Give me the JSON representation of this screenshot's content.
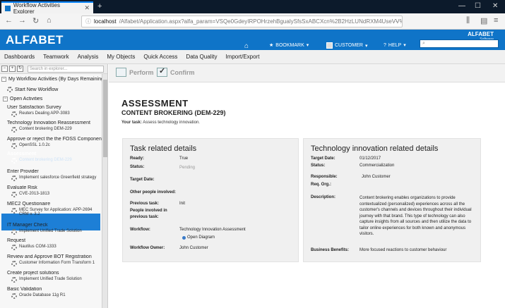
{
  "browser": {
    "tab_title": "Workflow Activities Explorer",
    "url_host": "localhost",
    "url_rest": "/Alfabet/Application.aspx?alfa_param=VSQe0GdeyIRPOHrzehBgualySfsSxABCXcn%2B2HzLUNdRXM4UseVV%2FbVP1S1B"
  },
  "app": {
    "logo": "ALFABET",
    "brand_right": "ALFABET",
    "brand_sub": "Software",
    "nav_bookmark": "BOOKMARK",
    "nav_customer": "CUSTOMER",
    "nav_help": "HELP"
  },
  "menu": [
    "Dashboards",
    "Teamwork",
    "Analysis",
    "My Objects",
    "Quick Access",
    "Data Quality",
    "Import/Export"
  ],
  "sidebar": {
    "search_placeholder": "Search in explorer...",
    "root": "My Workflow Activities (By Days Remaining",
    "start_new": "Start New Workflow",
    "open_activities": "Open Activities",
    "items": [
      {
        "title": "User Satisfaction Survey",
        "sub": "Reuters Dealing APP-3083"
      },
      {
        "title": "Technology Innovation Reassessment",
        "sub": "Content brokering DEM-229"
      },
      {
        "title": "Approve or reject the the FOSS Component",
        "sub": "OpenSSL 1.0.2c"
      },
      {
        "title": "Assessment",
        "sub": "Content brokering DEM-229"
      },
      {
        "title": "Enter Provider",
        "sub": "Implement salesforce Greenfield strategy"
      },
      {
        "title": "Evaluate Risk",
        "sub": "CVE-2013-1813"
      },
      {
        "title": "MEC2 Questionaire",
        "sub": "MEC Survey for Application: APP-2694 CRM v. 3.2"
      },
      {
        "title": "IT Manager Check",
        "sub": "Implement Unified Trade Solution"
      },
      {
        "title": "Request",
        "sub": "Nautilus COM-1333"
      },
      {
        "title": "Review and Approve BOT Registration",
        "sub": "Customer Information Form Transform 1"
      },
      {
        "title": "Create project solutions",
        "sub": "Implement Unified Trade Solution"
      },
      {
        "title": "Basic Validation",
        "sub": "Oracle Database 11g R1"
      }
    ]
  },
  "actions": {
    "perform": "Perform",
    "confirm": "Confirm"
  },
  "assessment": {
    "title": "ASSESSMENT",
    "subtitle": "CONTENT BROKERING (DEM-229)",
    "task_label": "Your task:",
    "task_text": "Assess technology innovation."
  },
  "task_panel": {
    "heading": "Task related details",
    "ready_label": "Ready:",
    "ready_value": "True",
    "status_label": "Status:",
    "status_value": "Pending",
    "target_label": "Target Date:",
    "others_label": "Other people involved:",
    "prev_task_label": "Previous task:",
    "prev_task_value": "Init",
    "people_prev_label_1": "People involved in",
    "people_prev_label_2": "previous task:",
    "workflow_label": "Workflow:",
    "workflow_value": "Technology Innovation Assessment",
    "open_diagram": "Open Diagram",
    "owner_label": "Workflow Owner:",
    "owner_value": "John Customer"
  },
  "tech_panel": {
    "heading": "Technology innovation related details",
    "target_label": "Target Date:",
    "target_value": "01/12/2017",
    "status_label": "Status:",
    "status_value": "Commercialization",
    "responsible_label": "Responsible:",
    "responsible_value": "John Customer",
    "req_org_label": "Req. Org.:",
    "description_label": "Description:",
    "description_value": "Content brokering enables organizations to provide contextualized (personalized) experiences across all the customer's channels and devices throughout their individual journey with that brand. This type of technology can also capture insights from all sources and then utilize the data to tailor online experiences for both known and anonymous visitors.",
    "benefits_label": "Business Benefits:",
    "benefits_value": "More focused reactions to customer behaviour"
  }
}
